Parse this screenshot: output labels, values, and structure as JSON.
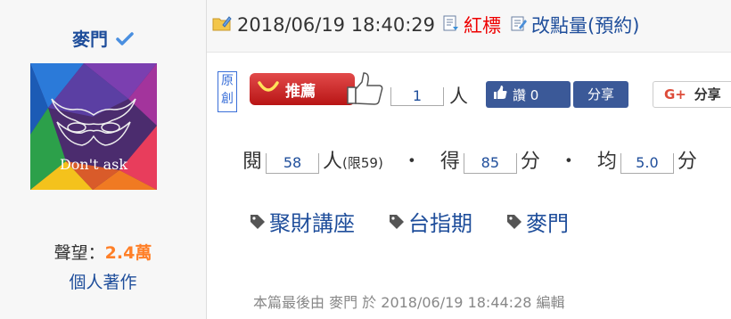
{
  "author": {
    "name": "麥門",
    "avatar_caption": "Don't ask",
    "reputation_label": "聲望：",
    "reputation_value": "2.4萬",
    "works_link": "個人著作"
  },
  "meta": {
    "datetime": "2018/06/19 18:40:29",
    "red_label": "紅標",
    "edit_points_label": "改點量(預約)"
  },
  "actions": {
    "original_badge": "原創",
    "recommend_label": "推薦",
    "recommend_count": "1",
    "person_unit": "人",
    "fb_like_label": "讚 0",
    "fb_share_label": "分享",
    "gplus_label": "分享"
  },
  "stats": {
    "read_label": "閱",
    "read_count": "58",
    "read_unit": "人",
    "read_limit": "(限59)",
    "score_label": "得",
    "score_value": "85",
    "score_unit": "分",
    "avg_label": "均",
    "avg_value": "5.0",
    "avg_unit": "分"
  },
  "tags": [
    "聚財講座",
    "台指期",
    "麥門"
  ],
  "footer": {
    "last_edit": "本篇最後由 麥門 於 2018/06/19 18:44:28 編輯"
  },
  "colors": {
    "link_blue": "#1f4e9b",
    "red": "#e00000",
    "orange": "#ff7f27",
    "facebook": "#3b5998"
  }
}
